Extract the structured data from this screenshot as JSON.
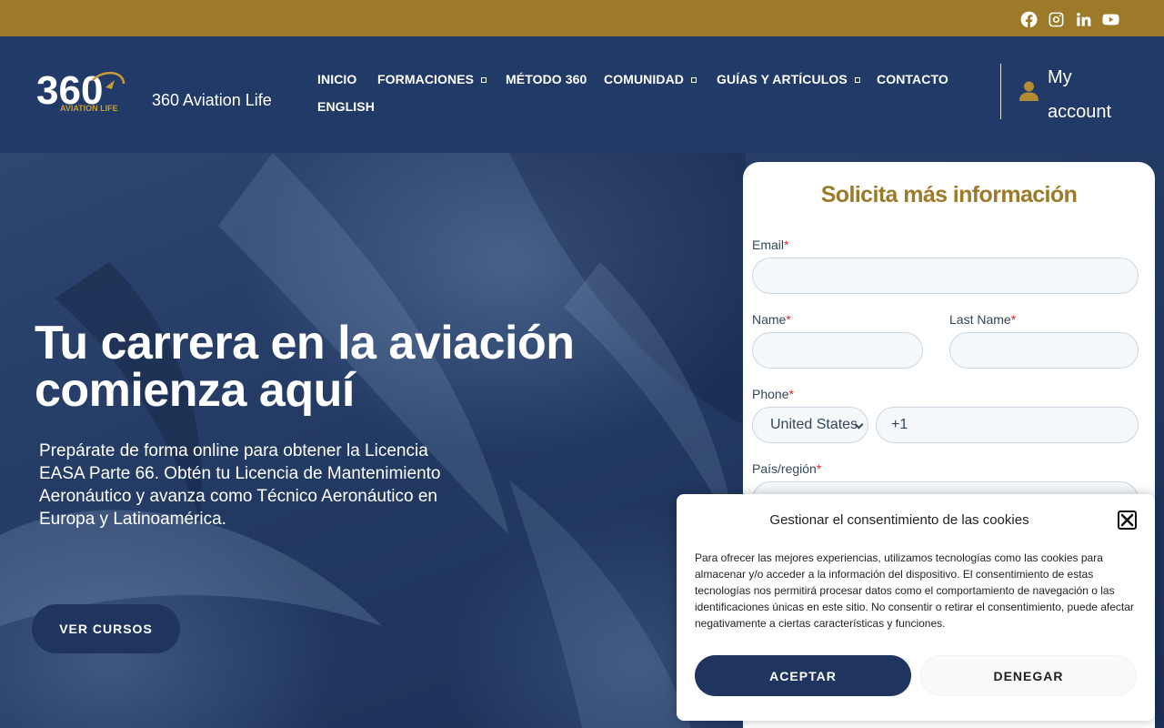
{
  "topbar": {
    "social": [
      "facebook-icon",
      "instagram-icon",
      "linkedin-icon",
      "youtube-icon"
    ]
  },
  "header": {
    "logo_text": "360",
    "logo_subtext": "AVIATION LIFE",
    "site_title": "360 Aviation Life",
    "nav": {
      "inicio": "INICIO",
      "formaciones": "FORMACIONES",
      "metodo": "MÉTODO 360",
      "comunidad": "COMUNIDAD",
      "guias": "GUÍAS Y ARTÍCULOS",
      "contacto": "CONTACTO",
      "english": "ENGLISH"
    },
    "account": {
      "line1": "My",
      "line2": "account"
    }
  },
  "hero": {
    "title_line1": "Tu carrera en la aviación",
    "title_line2": "comienza aquí",
    "subtitle": "Prepárate de forma online para obtener la Licencia EASA Parte 66. Obtén tu Licencia de Mantenimiento Aeronáutico y avanza como Técnico Aeronáutico en Europa y Latinoamérica.",
    "cta": "VER CURSOS"
  },
  "form": {
    "title": "Solicita más información",
    "email_label": "Email",
    "name_label": "Name",
    "lastname_label": "Last Name",
    "phone_label": "Phone",
    "country_select": "United States",
    "phone_value": "+1",
    "region_label": "País/región",
    "required_mark": "*"
  },
  "cookie": {
    "title": "Gestionar el consentimiento de las cookies",
    "text": "Para ofrecer las mejores experiencias, utilizamos tecnologías como las cookies para almacenar y/o acceder a la información del dispositivo. El consentimiento de estas tecnologías nos permitirá procesar datos como el comportamiento de navegación o las identificaciones únicas en este sitio. No consentir o retirar el consentimiento, puede afectar negativamente a ciertas características y funciones.",
    "accept": "ACEPTAR",
    "deny": "DENEGAR"
  },
  "colors": {
    "gold": "#9c7a2a",
    "navy": "#213a68",
    "button_navy": "#1f3560"
  }
}
